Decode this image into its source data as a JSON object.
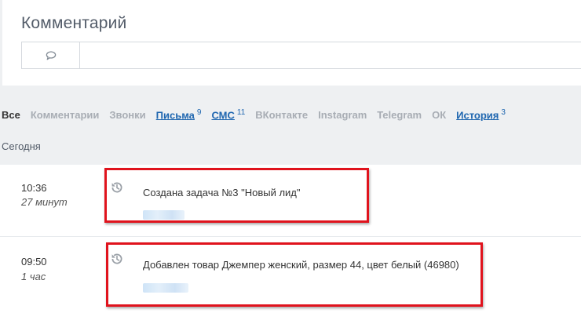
{
  "comment": {
    "title": "Комментарий",
    "icon": "speech-bubble-icon"
  },
  "filters": {
    "items": [
      {
        "label": "Все",
        "active": true
      },
      {
        "label": "Комментарии"
      },
      {
        "label": "Звонки"
      },
      {
        "label": "Письма",
        "count": "9",
        "link": true
      },
      {
        "label": "СМС",
        "count": "11",
        "link": true
      },
      {
        "label": "ВКонтакте"
      },
      {
        "label": "Instagram"
      },
      {
        "label": "Telegram"
      },
      {
        "label": "ОК"
      },
      {
        "label": "История",
        "count": "3",
        "link": true
      }
    ]
  },
  "feed": {
    "section_label": "Сегодня",
    "events": [
      {
        "time": "10:36",
        "ago": "27 минут",
        "text": "Создана задача №3 \"Новый лид\"",
        "icon": "history-icon"
      },
      {
        "time": "09:50",
        "ago": "1 час",
        "text": "Добавлен товар Джемпер женский, размер 44, цвет белый (46980)",
        "icon": "history-icon"
      }
    ]
  },
  "colors": {
    "link": "#2067b0",
    "highlight": "#e0131d",
    "feed_bg": "#eef0f2"
  }
}
